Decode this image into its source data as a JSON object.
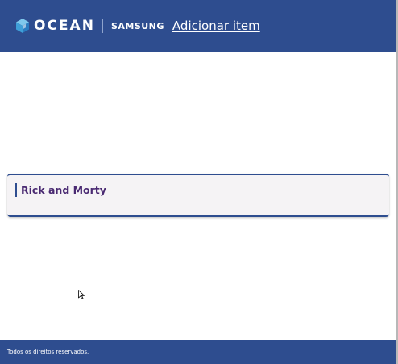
{
  "header": {
    "logo": {
      "cube_icon": "ocean-cube-icon",
      "ocean_label": "OCEAN",
      "partner_label": "SAMSUNG"
    },
    "nav_link_label": "Adicionar item"
  },
  "main": {
    "items": [
      {
        "title": "Rick and Morty"
      }
    ]
  },
  "footer": {
    "text": "Todos os direitos reservados."
  },
  "colors": {
    "brand_blue": "#2e4d8f",
    "card_background": "#f5f3f5",
    "item_link": "#4a2a72"
  }
}
